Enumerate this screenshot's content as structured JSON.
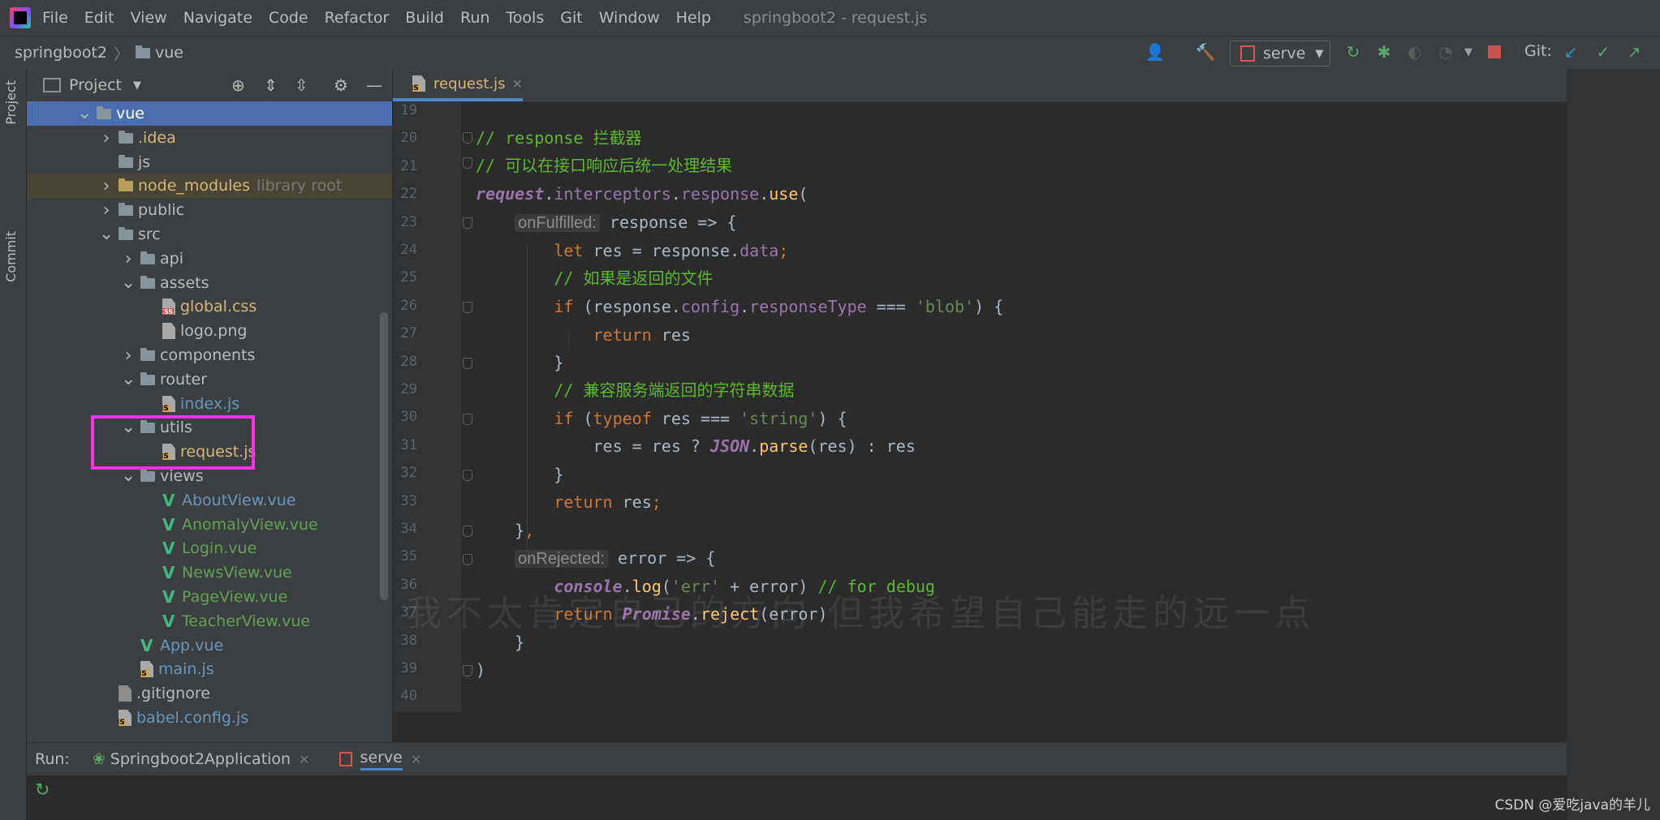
{
  "menubar": {
    "items": [
      "File",
      "Edit",
      "View",
      "Navigate",
      "Code",
      "Refactor",
      "Build",
      "Run",
      "Tools",
      "Git",
      "Window",
      "Help"
    ],
    "window_title": "springboot2 - request.js"
  },
  "navbar": {
    "breadcrumb": [
      "springboot2",
      "vue"
    ],
    "run_config": "serve",
    "git_label": "Git:"
  },
  "side_tabs": {
    "project": "Project",
    "commit": "Commit"
  },
  "project_panel": {
    "title": "Project",
    "tree": [
      {
        "label": "vue",
        "depth": 0,
        "kind": "folder",
        "expanded": true,
        "selected": true
      },
      {
        "label": ".idea",
        "depth": 1,
        "kind": "folder",
        "expanded": false,
        "color": "yellow"
      },
      {
        "label": "js",
        "depth": 1,
        "kind": "folder",
        "expanded": null
      },
      {
        "label": "node_modules",
        "suffix": "library root",
        "depth": 1,
        "kind": "folder-orange",
        "expanded": false,
        "color": "yellow",
        "excluded": true
      },
      {
        "label": "public",
        "depth": 1,
        "kind": "folder",
        "expanded": false
      },
      {
        "label": "src",
        "depth": 1,
        "kind": "folder",
        "expanded": true
      },
      {
        "label": "api",
        "depth": 2,
        "kind": "folder",
        "expanded": false
      },
      {
        "label": "assets",
        "depth": 2,
        "kind": "folder",
        "expanded": true
      },
      {
        "label": "global.css",
        "depth": 3,
        "kind": "css",
        "color": "yellow"
      },
      {
        "label": "logo.png",
        "depth": 3,
        "kind": "png"
      },
      {
        "label": "components",
        "depth": 2,
        "kind": "folder",
        "expanded": false
      },
      {
        "label": "router",
        "depth": 2,
        "kind": "folder",
        "expanded": true
      },
      {
        "label": "index.js",
        "depth": 3,
        "kind": "js",
        "color": "blue"
      },
      {
        "label": "utils",
        "depth": 2,
        "kind": "folder",
        "expanded": true
      },
      {
        "label": "request.js",
        "depth": 3,
        "kind": "js",
        "color": "yellow"
      },
      {
        "label": "views",
        "depth": 2,
        "kind": "folder",
        "expanded": true
      },
      {
        "label": "AboutView.vue",
        "depth": 3,
        "kind": "vue",
        "color": "blue"
      },
      {
        "label": "AnomalyView.vue",
        "depth": 3,
        "kind": "vue",
        "color": "green"
      },
      {
        "label": "Login.vue",
        "depth": 3,
        "kind": "vue",
        "color": "green"
      },
      {
        "label": "NewsView.vue",
        "depth": 3,
        "kind": "vue",
        "color": "green"
      },
      {
        "label": "PageView.vue",
        "depth": 3,
        "kind": "vue",
        "color": "green"
      },
      {
        "label": "TeacherView.vue",
        "depth": 3,
        "kind": "vue",
        "color": "green"
      },
      {
        "label": "App.vue",
        "depth": 2,
        "kind": "vue",
        "color": "blue"
      },
      {
        "label": "main.js",
        "depth": 2,
        "kind": "js",
        "color": "blue"
      },
      {
        "label": ".gitignore",
        "depth": 1,
        "kind": "git"
      },
      {
        "label": "babel.config.js",
        "depth": 1,
        "kind": "js",
        "color": "blue"
      }
    ]
  },
  "editor": {
    "tab": "request.js",
    "line_numbers": [
      "19",
      "20",
      "21",
      "22",
      "23",
      "24",
      "25",
      "26",
      "27",
      "28",
      "29",
      "30",
      "31",
      "32",
      "33",
      "34",
      "35",
      "36",
      "37",
      "38",
      "39",
      "40"
    ],
    "hints": {
      "on_fulfilled": "onFulfilled:",
      "on_rejected": "onRejected:"
    }
  },
  "run_bar": {
    "label": "Run:",
    "tabs": [
      "Springboot2Application",
      "serve"
    ]
  },
  "watermark": "我不太肯定自己的方向 但我希望自己能走的远一点",
  "csdn_credit": "CSDN @爱吃java的羊儿",
  "colors": {
    "accent": "#4b6eaf",
    "highlight_box": "#ff30e8"
  }
}
